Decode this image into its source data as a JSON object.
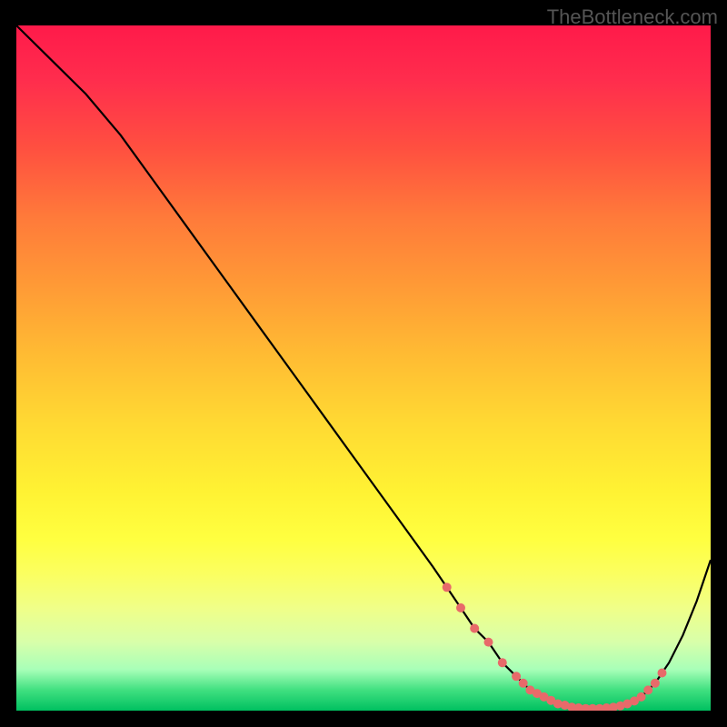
{
  "watermark": "TheBottleneck.com",
  "chart_data": {
    "type": "line",
    "title": "",
    "xlabel": "",
    "ylabel": "",
    "xlim": [
      0,
      100
    ],
    "ylim": [
      0,
      100
    ],
    "series": [
      {
        "name": "curve",
        "x": [
          0,
          6,
          10,
          15,
          20,
          25,
          30,
          35,
          40,
          45,
          50,
          55,
          60,
          62,
          64,
          66,
          68,
          70,
          72,
          74,
          76,
          78,
          80,
          82,
          84,
          86,
          88,
          90,
          92,
          94,
          96,
          98,
          100
        ],
        "y": [
          100,
          94,
          90,
          84,
          77,
          70,
          63,
          56,
          49,
          42,
          35,
          28,
          21,
          18,
          15,
          12,
          10,
          7,
          5,
          3,
          2,
          1,
          0.5,
          0.3,
          0.3,
          0.5,
          1,
          2,
          4,
          7,
          11,
          16,
          22
        ]
      }
    ],
    "markers": {
      "name": "points",
      "x": [
        62,
        64,
        66,
        68,
        70,
        72,
        73,
        74,
        75,
        76,
        77,
        78,
        79,
        80,
        81,
        82,
        83,
        84,
        85,
        86,
        87,
        88,
        89,
        90,
        91,
        92,
        93
      ],
      "y": [
        18,
        15,
        12,
        10,
        7,
        5,
        4,
        3,
        2.5,
        2,
        1.5,
        1,
        0.8,
        0.5,
        0.4,
        0.3,
        0.3,
        0.3,
        0.4,
        0.5,
        0.7,
        1,
        1.4,
        2,
        3,
        4,
        5.5
      ]
    },
    "marker_color": "#e86a6a",
    "line_color": "#000000"
  }
}
